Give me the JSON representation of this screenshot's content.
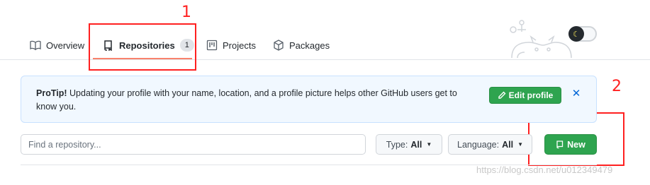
{
  "tabs": [
    {
      "label": "Overview",
      "icon": "book-icon"
    },
    {
      "label": "Repositories",
      "icon": "repo-icon",
      "count": "1",
      "selected": true
    },
    {
      "label": "Projects",
      "icon": "project-icon"
    },
    {
      "label": "Packages",
      "icon": "package-icon"
    }
  ],
  "annotations": {
    "first": "1",
    "second": "2",
    "color": "#ff2020"
  },
  "flash": {
    "bold": "ProTip!",
    "message": "Updating your profile with your name, location, and a profile picture helps other GitHub users get to know you.",
    "edit_button": "Edit profile",
    "close": "✕"
  },
  "filters": {
    "search_placeholder": "Find a repository...",
    "type_label": "Type:",
    "type_value": "All",
    "language_label": "Language:",
    "language_value": "All",
    "new_button": "New"
  },
  "watermark": "https://blog.csdn.net/u012349479",
  "colors": {
    "accent": "#2ea44f",
    "link": "#0366d6",
    "underline": "#f9826c"
  }
}
